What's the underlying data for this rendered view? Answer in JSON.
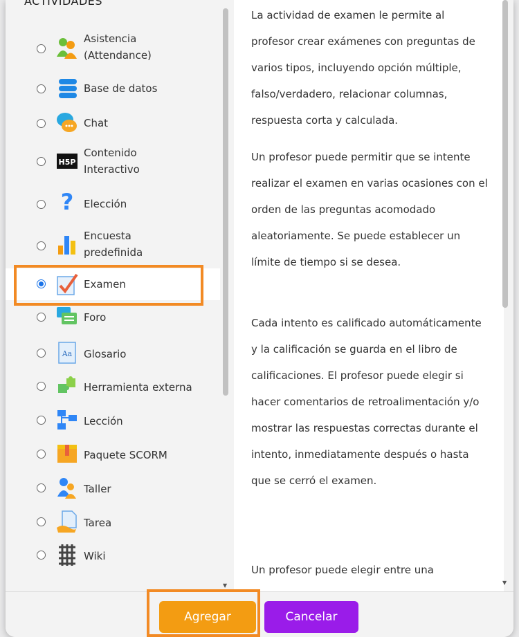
{
  "section_heading": "ACTIVIDADES",
  "activities": [
    {
      "label": "Asistencia\n(Attendance)",
      "icon": "attendance-icon",
      "selected": false
    },
    {
      "label": "Base de datos",
      "icon": "database-icon",
      "selected": false
    },
    {
      "label": "Chat",
      "icon": "chat-icon",
      "selected": false
    },
    {
      "label": "Contenido\nInteractivo",
      "icon": "h5p-icon",
      "selected": false
    },
    {
      "label": "Elección",
      "icon": "question-icon",
      "selected": false
    },
    {
      "label": "Encuesta\npredefinida",
      "icon": "survey-chart-icon",
      "selected": false
    },
    {
      "label": "Examen",
      "icon": "quiz-checkmark-icon",
      "selected": true
    },
    {
      "label": "Foro",
      "icon": "forum-icon",
      "selected": false
    },
    {
      "label": "Glosario",
      "icon": "glossary-icon",
      "selected": false
    },
    {
      "label": "Herramienta externa",
      "icon": "puzzle-icon",
      "selected": false
    },
    {
      "label": "Lección",
      "icon": "lesson-icon",
      "selected": false
    },
    {
      "label": "Paquete SCORM",
      "icon": "scorm-package-icon",
      "selected": false
    },
    {
      "label": "Taller",
      "icon": "workshop-icon",
      "selected": false
    },
    {
      "label": "Tarea",
      "icon": "assignment-icon",
      "selected": false
    },
    {
      "label": "Wiki",
      "icon": "wiki-icon",
      "selected": false
    }
  ],
  "description": [
    "La actividad de examen le permite al profesor crear exámenes con preguntas de varios tipos, incluyendo opción múltiple, falso/verdadero, relacionar columnas, respuesta corta y calculada.",
    "Un profesor puede permitir que se intente realizar el examen en varias ocasiones con el orden de las preguntas acomodado aleatoriamente. Se puede establecer un límite de tiempo si se desea.",
    "Cada intento es calificado automáticamente y la calificación se guarda en el libro de calificaciones. El profesor puede elegir si hacer comentarios de retroalimentación y/o mostrar las respuestas correctas durante el intento, inmediatamente después o hasta que se cerró el examen.",
    "Un profesor puede elegir entre una"
  ],
  "buttons": {
    "add": "Agregar",
    "cancel": "Cancelar"
  },
  "colors": {
    "add": "#f39c12",
    "cancel": "#9a1ce9",
    "highlight": "#f28a24",
    "radio": "#1a73e8"
  }
}
